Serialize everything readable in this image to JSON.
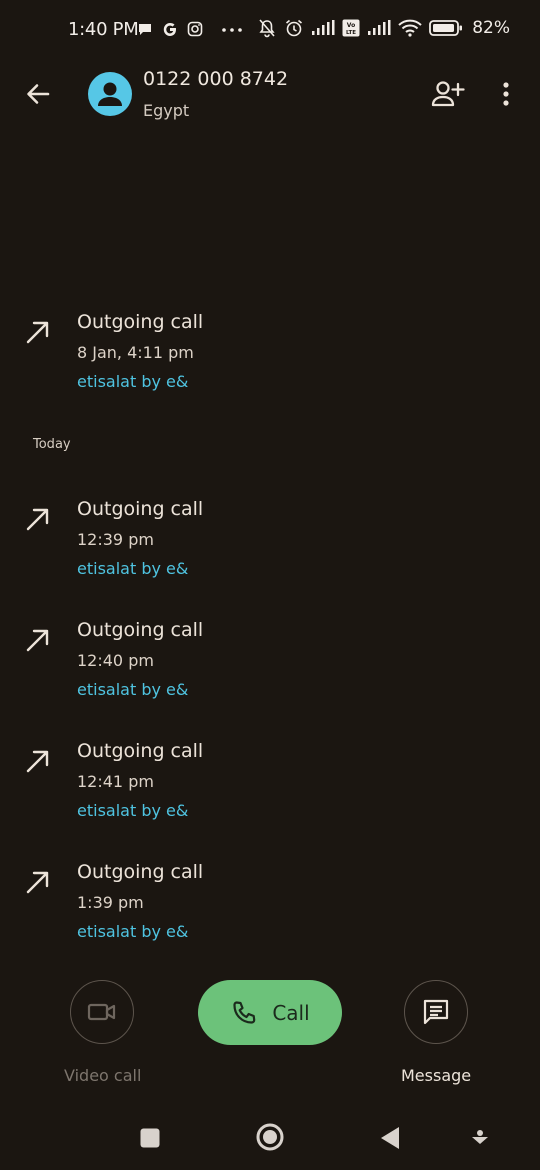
{
  "status_bar": {
    "time": "1:40 PM",
    "battery_pct": "82%",
    "icons": [
      "chat-bubble-icon",
      "google-g-icon",
      "instagram-icon",
      "more-dots-icon",
      "mute-bell-icon",
      "alarm-icon",
      "signal-icon",
      "volte-icon",
      "signal-icon",
      "wifi-icon",
      "battery-icon"
    ]
  },
  "header": {
    "number": "0122 000 8742",
    "country": "Egypt"
  },
  "history": {
    "section_label": "Today",
    "entries": [
      {
        "title": "Outgoing call",
        "time": "8 Jan, 4:11 pm",
        "carrier": "etisalat by e&"
      },
      {
        "title": "Outgoing call",
        "time": "12:39 pm",
        "carrier": "etisalat by e&"
      },
      {
        "title": "Outgoing call",
        "time": "12:40 pm",
        "carrier": "etisalat by e&"
      },
      {
        "title": "Outgoing call",
        "time": "12:41 pm",
        "carrier": "etisalat by e&"
      },
      {
        "title": "Outgoing call",
        "time": "1:39 pm",
        "carrier": "etisalat by e&"
      }
    ]
  },
  "actions": {
    "video_call": "Video call",
    "call": "Call",
    "message": "Message"
  },
  "colors": {
    "background": "#1b1611",
    "accent_blue": "#4fc3e0",
    "avatar": "#56c7e6",
    "call_green": "#6cc27a",
    "disabled_text": "#7d756d"
  }
}
